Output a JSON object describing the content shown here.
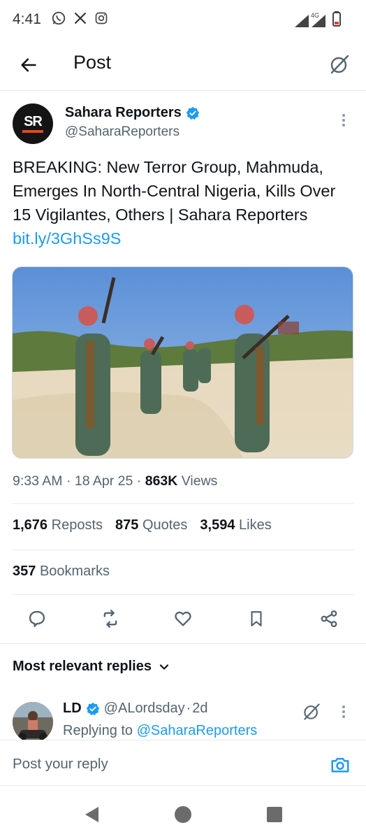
{
  "status_bar": {
    "time": "4:41",
    "network": "4G"
  },
  "header": {
    "title": "Post"
  },
  "post": {
    "author_name": "Sahara Reporters",
    "author_handle": "@SaharaReporters",
    "avatar_text": "SR",
    "text": "BREAKING: New Terror Group, Mahmuda, Emerges In North-Central Nigeria, Kills Over 15 Vigilantes, Others | Sahara Reporters ",
    "link": "bit.ly/3GhSs9S",
    "time": "9:33 AM",
    "date": "18 Apr 25",
    "views_count": "863K",
    "views_label": "Views",
    "reposts_count": "1,676",
    "reposts_label": "Reposts",
    "quotes_count": "875",
    "quotes_label": "Quotes",
    "likes_count": "3,594",
    "likes_label": "Likes",
    "bookmarks_count": "357",
    "bookmarks_label": "Bookmarks"
  },
  "replies": {
    "sort_label": "Most relevant replies",
    "items": [
      {
        "name": "LD",
        "handle": "@ALordsday",
        "age": "2d",
        "replying_prefix": "Replying to ",
        "replying_to": "@SaharaReporters"
      }
    ]
  },
  "compose": {
    "placeholder": "Post your reply"
  },
  "colors": {
    "accent": "#1d9bf0",
    "text": "#0f1419",
    "muted": "#536471",
    "divider": "#e7e9ea"
  },
  "icons": [
    "whatsapp-icon",
    "x-logo-icon",
    "instagram-icon",
    "signal-icon",
    "battery-icon",
    "back-arrow-icon",
    "grok-icon",
    "verified-badge-icon",
    "more-icon",
    "reply-icon",
    "repost-icon",
    "like-icon",
    "bookmark-icon",
    "share-icon",
    "chevron-down-icon",
    "camera-icon",
    "nav-back-icon",
    "nav-home-icon",
    "nav-recents-icon"
  ]
}
